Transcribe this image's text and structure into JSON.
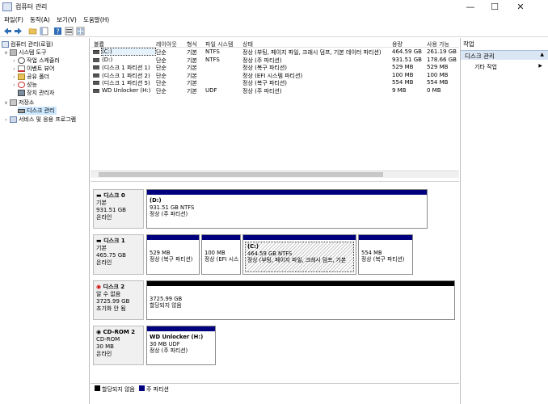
{
  "window": {
    "title": "컴퓨터 관리"
  },
  "menu": [
    "파일(F)",
    "동작(A)",
    "보기(V)",
    "도움말(H)"
  ],
  "tree": {
    "root": "컴퓨터 관리(로컬)",
    "system_tools": "시스템 도구",
    "task_scheduler": "작업 스케줄러",
    "event_viewer": "이벤트 뷰어",
    "shared_folders": "공유 폴더",
    "performance": "성능",
    "device_manager": "장치 관리자",
    "storage": "저장소",
    "disk_management": "디스크 관리",
    "services": "서비스 및 응용 프로그램"
  },
  "volume_columns": [
    "볼륨",
    "레이아웃",
    "형식",
    "파일 시스템",
    "상태",
    "용량",
    "사용 가능"
  ],
  "volumes": [
    [
      "(C:)",
      "단순",
      "기본",
      "NTFS",
      "정상 (부팅, 페이지 파일, 크래시 덤프, 기본 데이터 파티션)",
      "464.59 GB",
      "261.19 GB"
    ],
    [
      "(D:)",
      "단순",
      "기본",
      "NTFS",
      "정상 (주 파티션)",
      "931.51 GB",
      "178.66 GB"
    ],
    [
      "(디스크 1 파티션 1)",
      "단순",
      "기본",
      "",
      "정상 (복구 파티션)",
      "529 MB",
      "529 MB"
    ],
    [
      "(디스크 1 파티션 2)",
      "단순",
      "기본",
      "",
      "정상 (EFI 시스템 파티션)",
      "100 MB",
      "100 MB"
    ],
    [
      "(디스크 1 파티션 5)",
      "단순",
      "기본",
      "",
      "정상 (복구 파티션)",
      "554 MB",
      "554 MB"
    ],
    [
      "WD Unlocker (H:)",
      "단순",
      "기본",
      "UDF",
      "정상 (주 파티션)",
      "9 MB",
      "0 MB"
    ]
  ],
  "disks": [
    {
      "name": "디스크 0",
      "type": "기본",
      "size": "931.51 GB",
      "status": "온라인",
      "partitions": [
        {
          "title": "(D:)",
          "line1": "931.51 GB NTFS",
          "line2": "정상 (주 파티션)"
        }
      ]
    },
    {
      "name": "디스크 1",
      "type": "기본",
      "size": "465.75 GB",
      "status": "온라인",
      "partitions": [
        {
          "title": "",
          "line1": "529 MB",
          "line2": "정상 (복구 파티션)"
        },
        {
          "title": "",
          "line1": "100 MB",
          "line2": "정상 (EFI 시스"
        },
        {
          "title": "(C:)",
          "line1": "464.59 GB NTFS",
          "line2": "정상 (부팅, 페이지 파일, 크래시 덤프, 기본"
        },
        {
          "title": "",
          "line1": "554 MB",
          "line2": "정상 (복구 파티션)"
        }
      ]
    },
    {
      "name": "디스크 2",
      "type": "알 수 없음",
      "size": "3725.99 GB",
      "status": "초기화 안 됨",
      "partitions": [
        {
          "title": "",
          "line1": "3725.99 GB",
          "line2": "할당되지 않음"
        }
      ]
    },
    {
      "name": "CD-ROM 2",
      "type": "CD-ROM",
      "size": "30 MB",
      "status": "온라인",
      "partitions": [
        {
          "title": "WD Unlocker  (H:)",
          "line1": "30 MB UDF",
          "line2": "정상 (주 파티션)"
        }
      ]
    }
  ],
  "legend": {
    "unallocated": "할당되지 않음",
    "primary": "주 파티션"
  },
  "actions": {
    "header": "작업",
    "section": "디스크 관리",
    "more": "기타 작업"
  },
  "colors": {
    "primary_bar": "#00007f",
    "unallocated_bar": "#000000",
    "selection": "#cde8ff"
  }
}
